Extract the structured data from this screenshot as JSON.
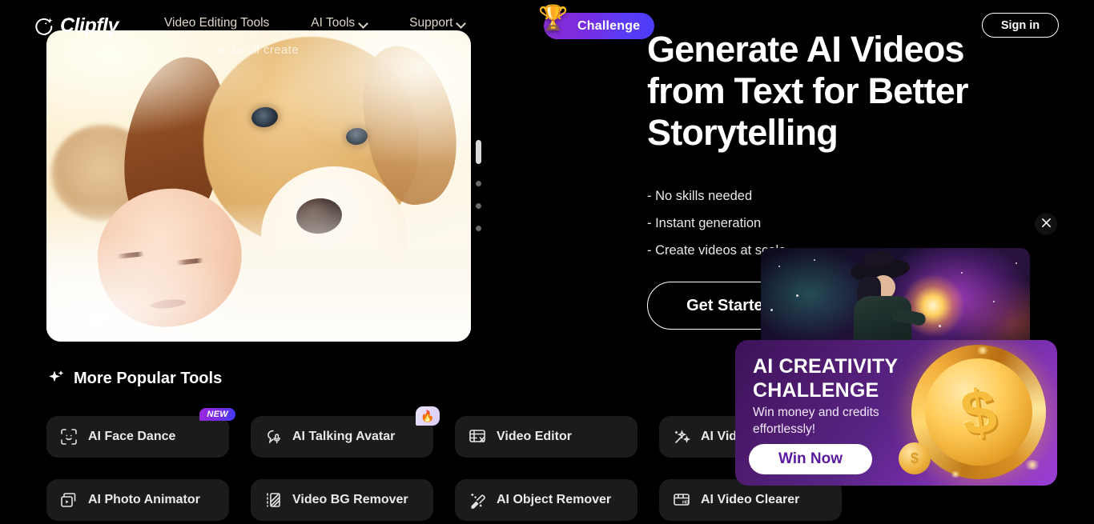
{
  "site": {
    "logo_text": "Clipfly",
    "logo_icon": "sparkle-circle-icon"
  },
  "nav": {
    "links": [
      {
        "label": "Video Editing Tools",
        "has_dropdown": false
      },
      {
        "label": "AI Tools",
        "has_dropdown": true
      },
      {
        "label": "Support",
        "has_dropdown": true
      }
    ],
    "challenge_badge": {
      "label": "Challenge",
      "icon": "trophy-icon"
    },
    "signin_label": "Sign in"
  },
  "hero": {
    "video_overlay_text": "e de                     ull create",
    "title": "Generate AI Videos from Text for Better Storytelling",
    "bullets": [
      "- No skills needed",
      "- Instant generation",
      "- Create videos at scale"
    ],
    "cta_label": "Get Started",
    "carousel": {
      "total": 4,
      "active_index": 0
    }
  },
  "tools_section": {
    "heading": "More Popular Tools",
    "heading_icon": "sparkle-icon",
    "cards": [
      {
        "label": "AI Face Dance",
        "icon": "face-scan-icon",
        "badge": "NEW",
        "badge_type": "new"
      },
      {
        "label": "AI Talking Avatar",
        "icon": "avatar-mic-icon",
        "badge": "🔥",
        "badge_type": "fire"
      },
      {
        "label": "Video Editor",
        "icon": "film-cut-icon",
        "badge": "",
        "badge_type": "none"
      },
      {
        "label": "AI Video Enhancer",
        "icon": "magic-wand-icon",
        "badge": "",
        "badge_type": "none"
      },
      {
        "label": "AI Photo Animator",
        "icon": "photo-play-icon",
        "badge": "",
        "badge_type": "none"
      },
      {
        "label": "Video BG Remover",
        "icon": "bg-remove-icon",
        "badge": "",
        "badge_type": "none"
      },
      {
        "label": "AI Object Remover",
        "icon": "eraser-sparkle-icon",
        "badge": "",
        "badge_type": "none"
      },
      {
        "label": "AI Video Clearer",
        "icon": "film-hd-icon",
        "badge": "",
        "badge_type": "none"
      }
    ]
  },
  "promo": {
    "close_icon": "close-icon",
    "thumbnail_alt": "cosmic-wizard-image",
    "title": "AI CREATIVITY CHALLENGE",
    "subtitle": "Win money and credits effortlessly!",
    "button_label": "Win Now",
    "coin_symbol": "$",
    "coin_small_symbol": "$"
  },
  "colors": {
    "background": "#000000",
    "accent_purple": "#7a2be0",
    "accent_blue": "#4b3df7",
    "card_bg": "#1b1b1b",
    "promo_text": "#5a1a9c"
  }
}
